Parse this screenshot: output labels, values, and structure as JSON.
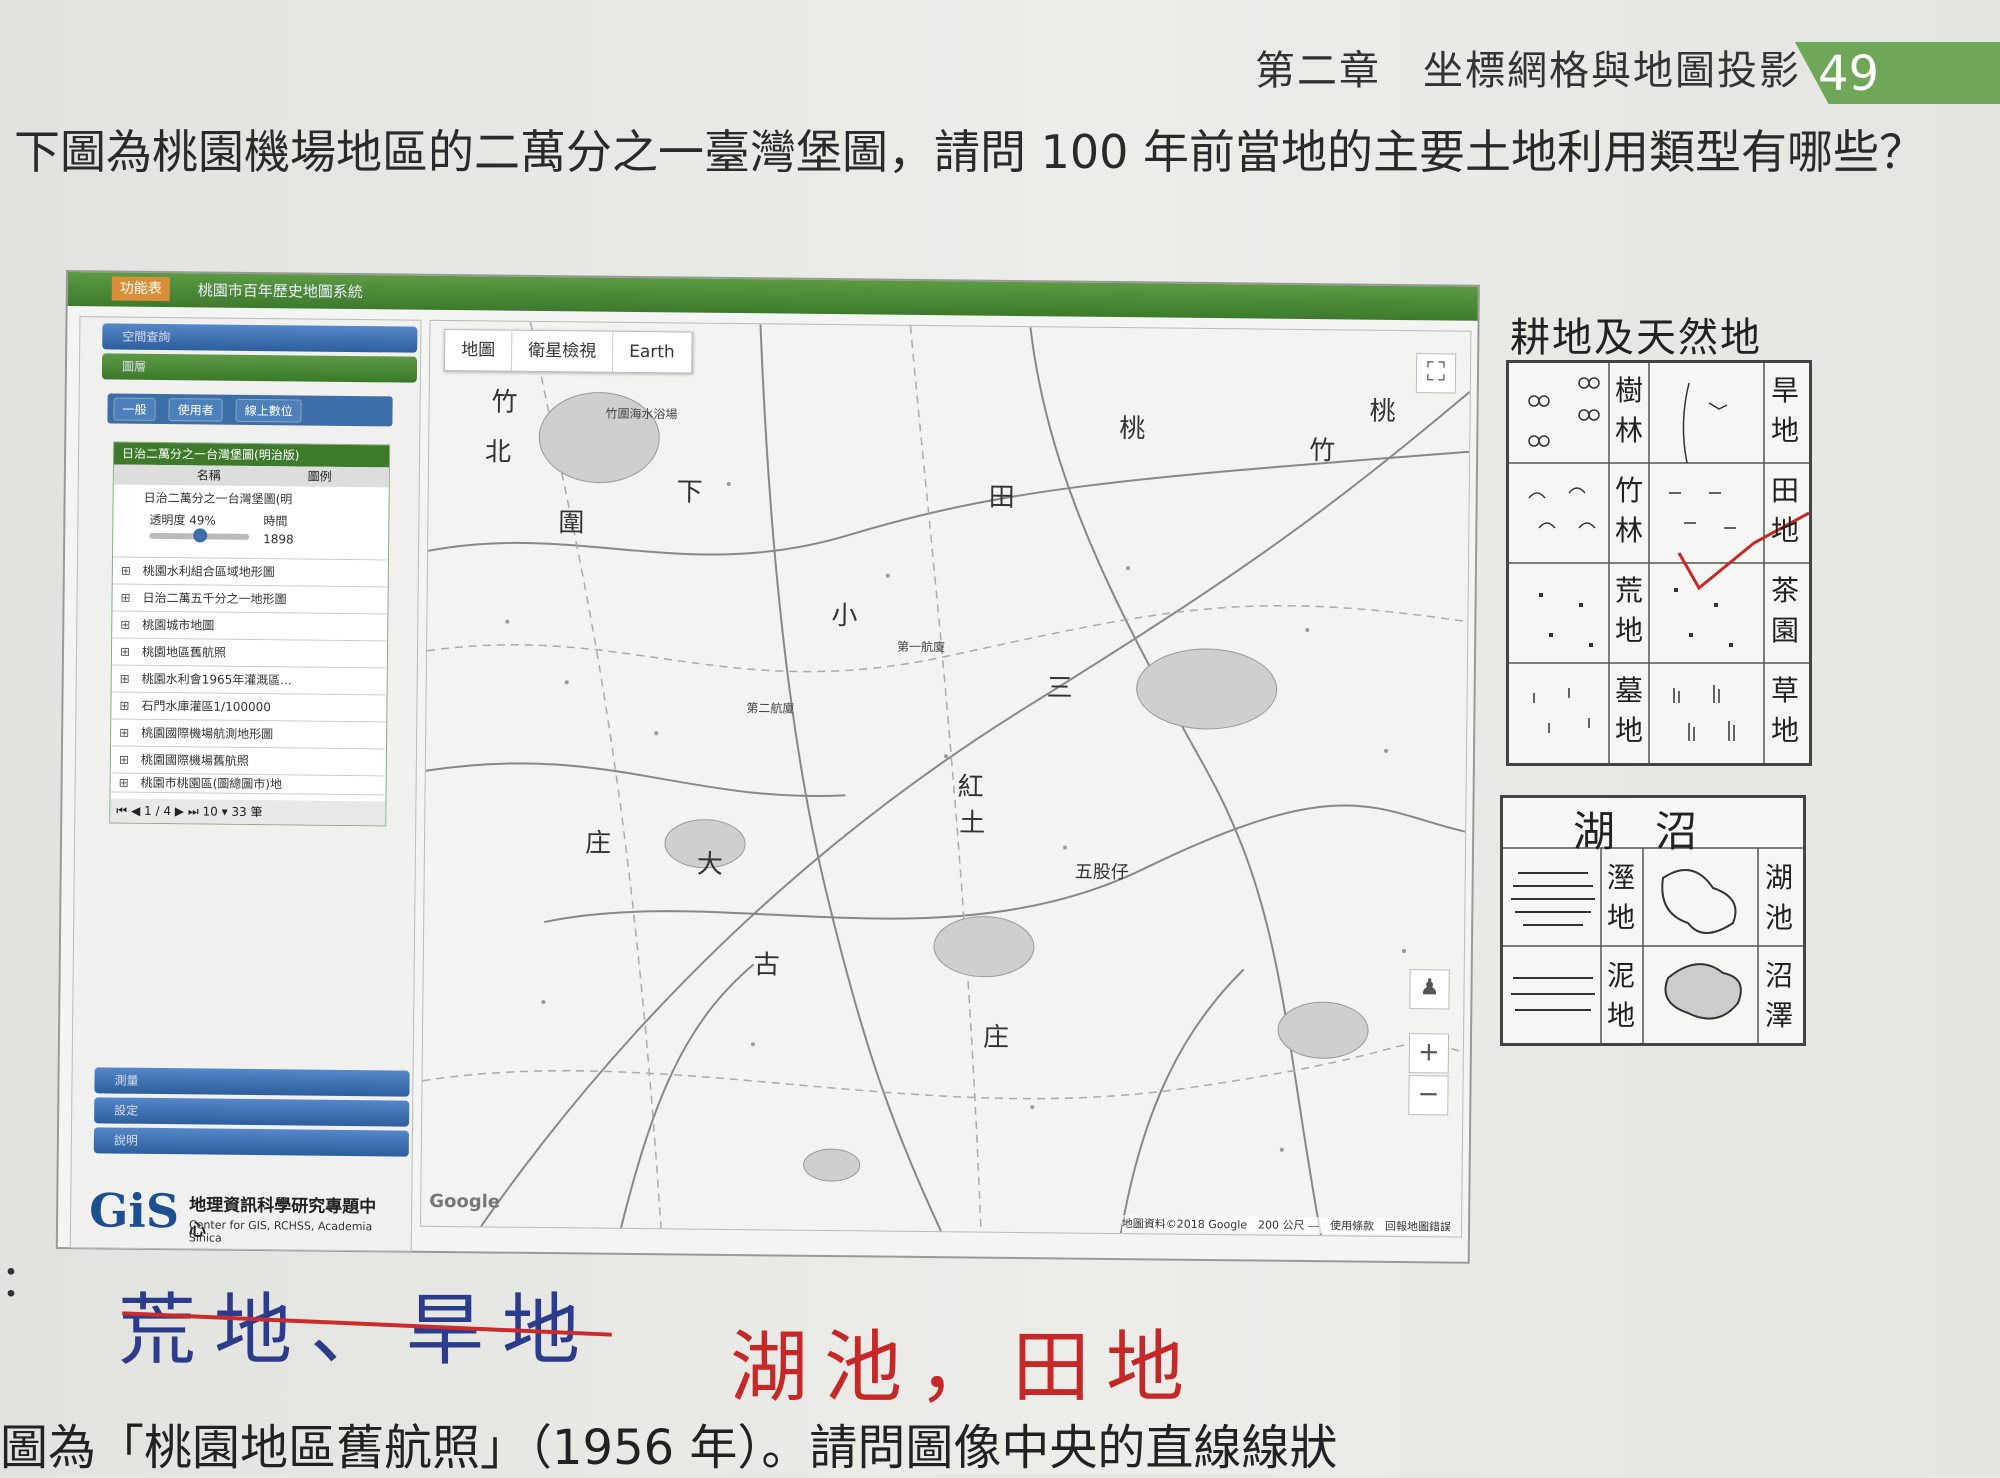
{
  "header": {
    "chapter": "第二章　坐標網格與地圖投影",
    "page_number": "49",
    "accent_color": "#6fa658"
  },
  "question": {
    "text": "下圖為桃園機場地區的二萬分之一臺灣堡圖，請問 100 年前當地的主要土地利用類型有哪些？"
  },
  "screenshot": {
    "top_button": "功能表",
    "app_title": "桃園市百年歷史地圖系統",
    "side_sections": [
      "空間查詢",
      "圖層",
      "測量",
      "設定",
      "說明"
    ],
    "side_tabs": [
      "一般",
      "使用者",
      "線上數位"
    ],
    "layer_panel_title": "日治二萬分之一台灣堡圖(明治版)",
    "layer_columns": [
      "名稱",
      "圖例"
    ],
    "selected_layer": "日治二萬分之一台灣堡圖(明",
    "opacity_label": "透明度 49%",
    "time_label": "時間",
    "time_value": "1898",
    "layers": [
      "桃園水利組合區域地形圖",
      "日治二萬五千分之一地形圖",
      "桃園城市地圖",
      "桃園地區舊航照",
      "桃園水利會1965年灌溉區...",
      "石門水庫灌區1/100000",
      "桃園國際機場航測地形圖",
      "桃園國際機場舊航照",
      "桃園市桃園區(圖總圖市)地"
    ],
    "pager": {
      "page": "1",
      "total_pages": "4",
      "per_page": "10 ▾",
      "count": "33 筆"
    },
    "gis_logo": {
      "mark": "GiS",
      "name": "地理資訊科學研究專題中心",
      "english": "Center for GIS, RCHSS, Academia Sinica"
    },
    "map_tabs": [
      "地圖",
      "衛星檢視",
      "Earth"
    ],
    "map_controls": {
      "fullscreen": "⛶",
      "zoom_in": "+",
      "zoom_out": "−"
    },
    "map_labels": [
      "竹",
      "北",
      "桃",
      "竹",
      "圍",
      "下",
      "田",
      "小",
      "大",
      "庄",
      "五股仔",
      "古",
      "庄",
      "紅",
      "土",
      "三",
      "桃"
    ],
    "map_small_labels": [
      "竹圍海水浴場",
      "第二航廈",
      "第一航廈"
    ],
    "google_logo": "Google",
    "attribution": "地圖資料©2018 Google　200 公尺 ⎯⎯　使用條款　回報地圖錯誤"
  },
  "legend_farm": {
    "title": "耕地及天然地",
    "rows": [
      {
        "left": "樹林",
        "right": "旱地"
      },
      {
        "left": "竹林",
        "right": "田地"
      },
      {
        "left": "荒地",
        "right": "茶園"
      },
      {
        "left": "墓地",
        "right": "草地"
      }
    ]
  },
  "legend_lake": {
    "title": "湖沼",
    "rows": [
      {
        "left": "溼地",
        "right": "湖池"
      },
      {
        "left": "泥地",
        "right": "沼澤"
      }
    ]
  },
  "answer": {
    "prefix": "：",
    "struck_text": "荒地、旱地",
    "final_text": "湖池，田地",
    "ink_blue": "#2c3c8c",
    "ink_red": "#c62828"
  },
  "next_question": {
    "text": "圖為「桃園地區舊航照」（1956 年）。請問圖像中央的直線線狀"
  }
}
